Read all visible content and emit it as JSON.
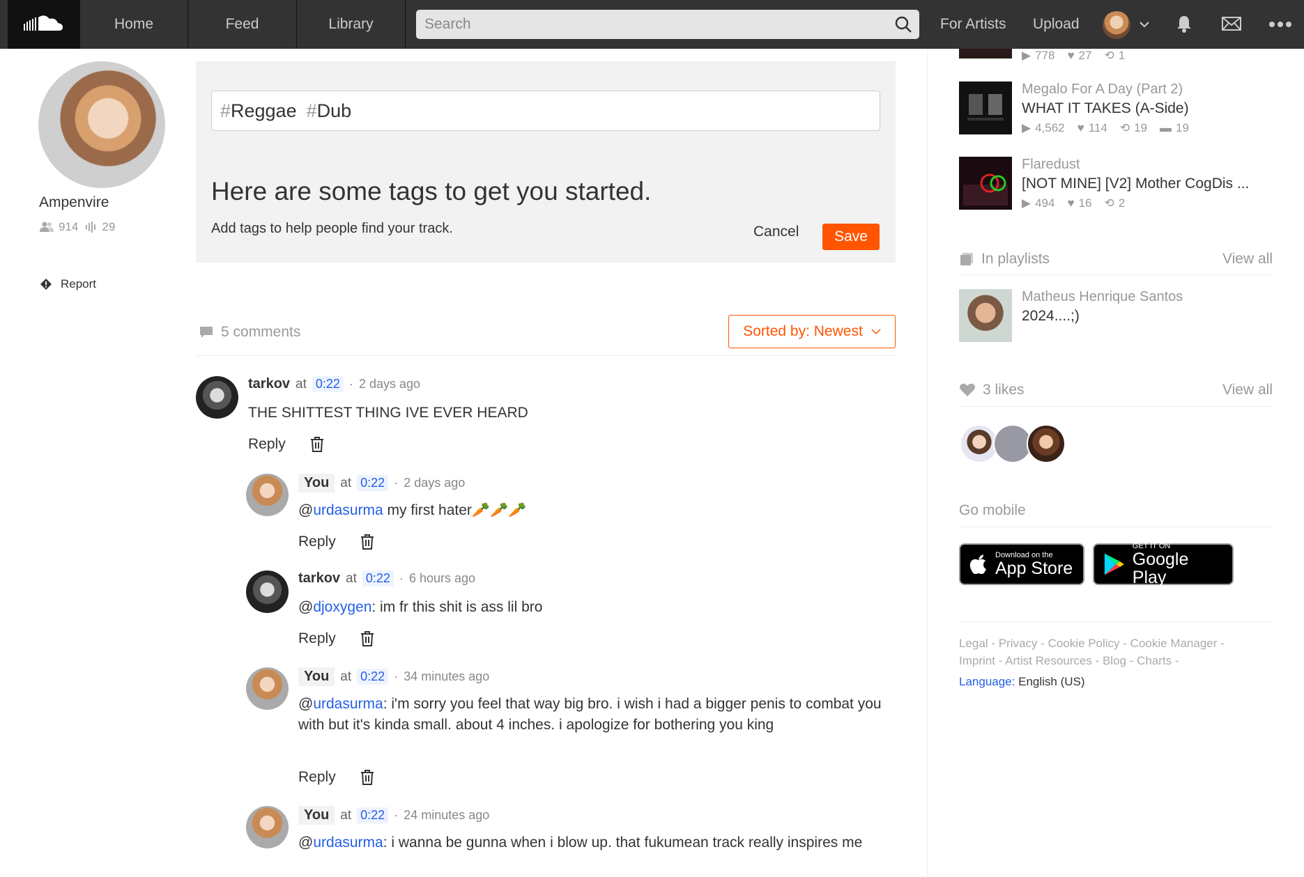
{
  "nav": {
    "home": "Home",
    "feed": "Feed",
    "library": "Library",
    "search_placeholder": "Search",
    "for_artists": "For Artists",
    "upload": "Upload"
  },
  "artist": {
    "name": "Ampenvire",
    "followers": "914",
    "tracks": "29",
    "report": "Report"
  },
  "tag_editor": {
    "tags": [
      "Reggae",
      "Dub"
    ],
    "heading": "Here are some tags to get you started.",
    "subtext": "Add tags to help people find your track.",
    "cancel": "Cancel",
    "save": "Save"
  },
  "comments_section": {
    "count_label": "5 comments",
    "sort_label": "Sorted by: Newest",
    "at": "at",
    "reply": "Reply",
    "items": [
      {
        "user": "tarkov",
        "ts": "0:22",
        "ago": "2 days ago",
        "mention": "",
        "text": "THE SHITTEST THING IVE EVER HEARD"
      },
      {
        "user": "You",
        "ts": "0:22",
        "ago": "2 days ago",
        "mention": "urdasurma",
        "text": " my first hater🥕🥕🥕"
      },
      {
        "user": "tarkov",
        "ts": "0:22",
        "ago": "6 hours ago",
        "mention": "djoxygen",
        "text": ": im fr this shit is ass lil bro"
      },
      {
        "user": "You",
        "ts": "0:22",
        "ago": "34 minutes ago",
        "mention": "urdasurma",
        "text": ": i'm sorry you feel that way big bro. i wish i had a bigger penis to combat you with but it's kinda small. about 4 inches. i apologize for bothering you king"
      },
      {
        "user": "You",
        "ts": "0:22",
        "ago": "24 minutes ago",
        "mention": "urdasurma",
        "text": ": i wanna be gunna when i blow up. that fukumean track really inspires me"
      }
    ]
  },
  "related_tracks": [
    {
      "plays": "778",
      "likes": "27",
      "reposts": "1"
    },
    {
      "artist": "Megalo For A Day (Part 2)",
      "title": "WHAT IT TAKES (A-Side)",
      "plays": "4,562",
      "likes": "114",
      "reposts": "19",
      "comments": "19"
    },
    {
      "artist": "Flaredust",
      "title": "[NOT MINE] [V2] Mother CogDis ...",
      "plays": "494",
      "likes": "16",
      "reposts": "2"
    }
  ],
  "playlists": {
    "label": "In playlists",
    "view_all": "View all",
    "item_user": "Matheus Henrique Santos",
    "item_title": "2024....;)"
  },
  "likes": {
    "label": "3 likes",
    "view_all": "View all"
  },
  "mobile": {
    "label": "Go mobile",
    "appstore_small": "Download on the",
    "appstore_big": "App Store",
    "play_small": "GET IT ON",
    "play_big": "Google Play"
  },
  "footer": {
    "links": [
      "Legal",
      "Privacy",
      "Cookie Policy",
      "Cookie Manager",
      "Imprint",
      "Artist Resources",
      "Blog",
      "Charts"
    ],
    "lang_key": "Language:",
    "lang_value": "English (US)"
  },
  "colors": {
    "accent": "#ff5500",
    "link": "#235ee8",
    "header": "#333333"
  }
}
